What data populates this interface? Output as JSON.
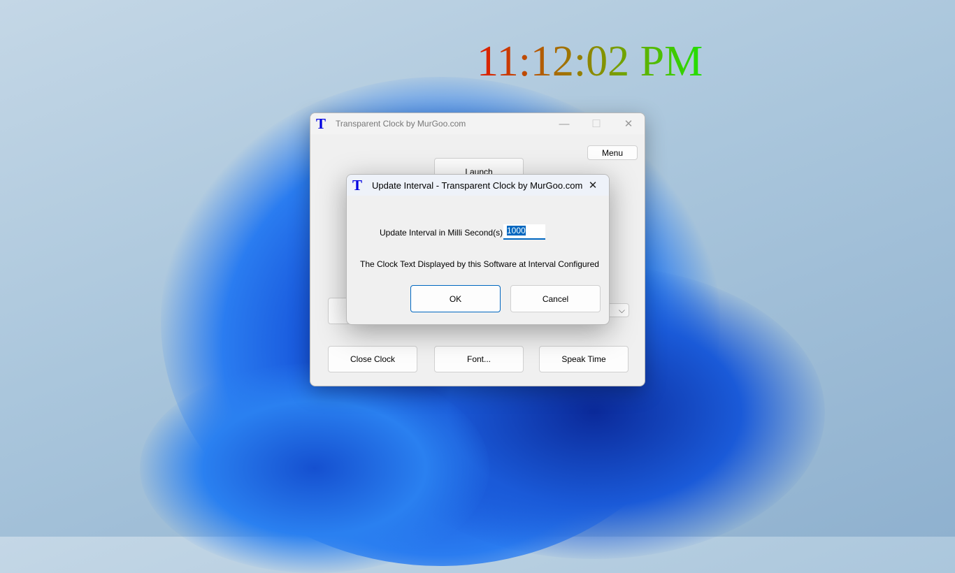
{
  "desktop": {
    "clock_text": "11:12:02 PM"
  },
  "main_window": {
    "title": "Transparent Clock by MurGoo.com",
    "logo": "T",
    "menu": "Menu",
    "launch": "Launch",
    "close_clock": "Close Clock",
    "font": "Font...",
    "speak_time": "Speak Time"
  },
  "dialog": {
    "title": "Update Interval - Transparent Clock by MurGoo.com",
    "logo": "T",
    "label": "Update Interval in Milli Second(s) :",
    "value": "1000",
    "note": "The Clock Text Displayed by this Software at Interval Configured",
    "ok": "OK",
    "cancel": "Cancel"
  },
  "colors": {
    "accent": "#0067c0",
    "logo": "#0000e0"
  }
}
